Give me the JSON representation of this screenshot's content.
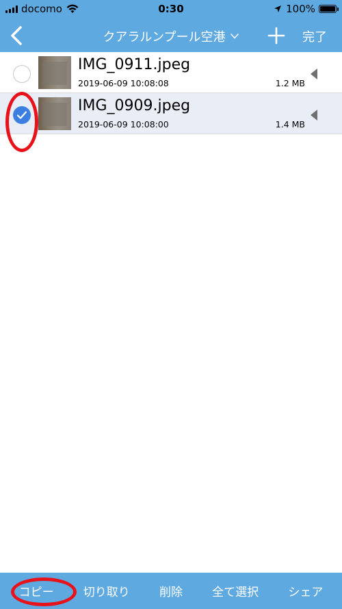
{
  "status_bar": {
    "carrier": "docomo",
    "time": "0:30",
    "battery_text": "100%",
    "battery_level": 1.0
  },
  "nav": {
    "title": "クアラルンプール空港",
    "done_label": "完了",
    "icons": [
      "back-chevron-icon",
      "chevron-down-icon",
      "plus-icon"
    ]
  },
  "files": [
    {
      "name": "IMG_0911.jpeg",
      "date": "2019-06-09 10:08:08",
      "size": "1.2 MB",
      "selected": false
    },
    {
      "name": "IMG_0909.jpeg",
      "date": "2019-06-09 10:08:00",
      "size": "1.4 MB",
      "selected": true
    }
  ],
  "toolbar": {
    "copy": "コピー",
    "cut": "切り取り",
    "delete": "削除",
    "select_all": "全て選択",
    "share": "シェア"
  },
  "colors": {
    "bar_blue": "#5ea9e0",
    "check_blue": "#3b7fe0",
    "selected_row": "#e9eef6",
    "annotation_red": "#e8121b"
  }
}
